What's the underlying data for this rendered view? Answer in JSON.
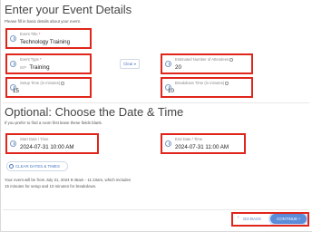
{
  "section_details": {
    "title": "Enter your Event Details",
    "subtitle": "Please fill in basic details about your event."
  },
  "event_title": {
    "label": "Event Title",
    "required_mark": "*",
    "value": "Technology Training"
  },
  "event_type": {
    "label": "Event Type",
    "required_mark": "*",
    "prefix": "IEP",
    "value": "Training"
  },
  "clear_type_button": "Clear",
  "attendees": {
    "label": "Estimated Number of Attendees",
    "value": "20"
  },
  "setup_time": {
    "label": "Setup Time (in minutes)",
    "value": "15"
  },
  "breakdown_time": {
    "label": "Breakdown Time (in minutes)",
    "value": "10"
  },
  "section_datetime": {
    "title": "Optional: Choose the Date & Time",
    "subtitle": "If you prefer to find a room first leave these fields blank."
  },
  "start_datetime": {
    "label": "Start Date / Time",
    "value": "2024-07-31 10:00 AM"
  },
  "end_datetime": {
    "label": "End Date / Time",
    "value": "2024-07-31 11:00 AM"
  },
  "clear_dates_button": "CLEAR DATES & TIMES",
  "summary_text": {
    "line1": "Your event will be from July 31, 2024 9:45am - 11:10am, which includes",
    "line2": "15 minutes for setup and 10 minutes for breakdown."
  },
  "footer": {
    "back_label": "GO BACK",
    "continue_label": "CONTINUE"
  },
  "colors": {
    "highlight": "#e0251b",
    "accent": "#5b8bd9"
  }
}
